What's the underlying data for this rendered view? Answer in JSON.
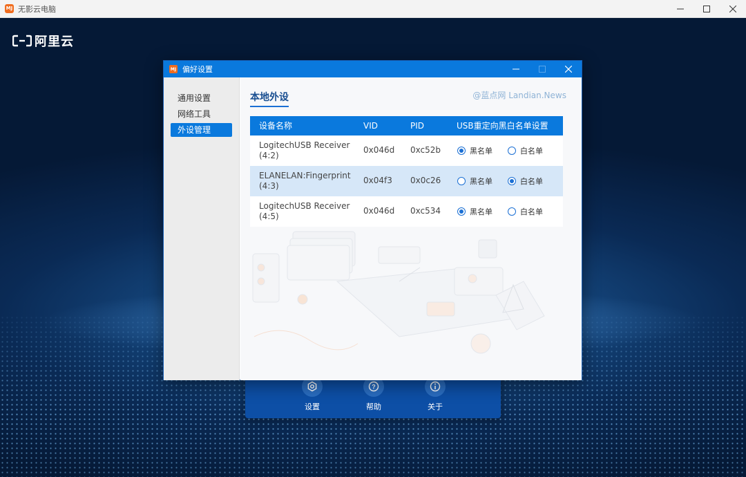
{
  "window": {
    "title": "无影云电脑",
    "app_icon_text": "MJ"
  },
  "brand": {
    "text": "阿里云"
  },
  "dialog": {
    "title": "偏好设置",
    "icon_text": "MJ",
    "sidebar": {
      "items": [
        {
          "label": "通用设置",
          "active": false
        },
        {
          "label": "网络工具",
          "active": false
        },
        {
          "label": "外设管理",
          "active": true
        }
      ]
    },
    "content": {
      "section_title": "本地外设",
      "watermark": "@蓝点网 Landian.News",
      "table": {
        "headers": [
          "设备名称",
          "VID",
          "PID",
          "USB重定向黑白名单设置"
        ],
        "rows": [
          {
            "name": "LogitechUSB Receiver(4:2)",
            "vid": "0x046d",
            "pid": "0xc52b",
            "option_a": "黑名单",
            "option_b": "白名单",
            "selected": "黑名单"
          },
          {
            "name": "ELANELAN:Fingerprint(4:3)",
            "vid": "0x04f3",
            "pid": "0x0c26",
            "option_a": "黑名单",
            "option_b": "白名单",
            "selected": "白名单"
          },
          {
            "name": "LogitechUSB Receiver(4:5)",
            "vid": "0x046d",
            "pid": "0xc534",
            "option_a": "黑名单",
            "option_b": "白名单",
            "selected": "黑名单"
          }
        ]
      }
    }
  },
  "bottom_nav": {
    "items": [
      {
        "label": "设置",
        "icon": "gear-icon"
      },
      {
        "label": "帮助",
        "icon": "help-icon"
      },
      {
        "label": "关于",
        "icon": "info-icon"
      }
    ]
  },
  "colors": {
    "accent": "#0a79dd",
    "title_blue": "#1a4f91",
    "selected_row": "#d6e7f8",
    "app_icon": "#f06c1e"
  }
}
